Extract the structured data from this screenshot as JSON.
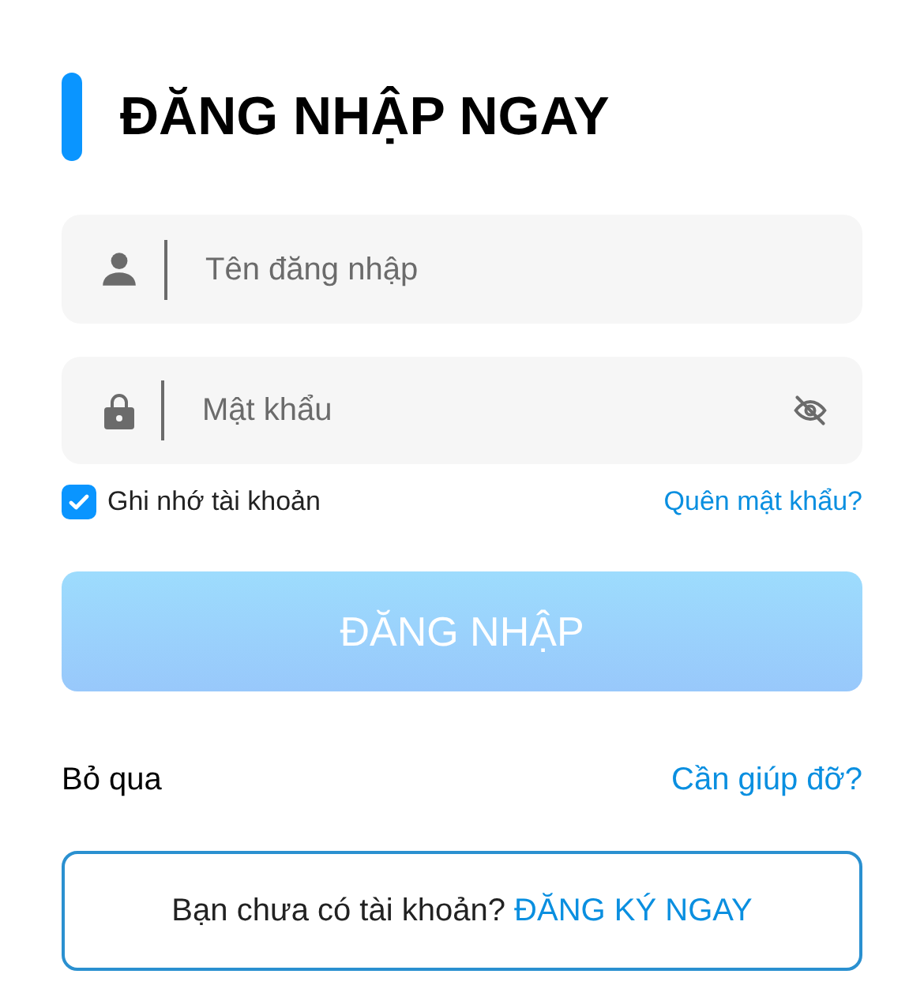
{
  "title": "ĐĂNG NHẬP NGAY",
  "username": {
    "placeholder": "Tên đăng nhập"
  },
  "password": {
    "placeholder": "Mật khẩu"
  },
  "remember": {
    "label": "Ghi nhớ tài khoản",
    "checked": true
  },
  "forgot_link": "Quên mật khẩu?",
  "login_button": {
    "label": "ĐĂNG NHẬP",
    "disabled": true
  },
  "skip_link": "Bỏ qua",
  "help_link": "Cần giúp đỡ?",
  "register": {
    "prompt": "Bạn chưa có tài khoản?",
    "link": "ĐĂNG KÝ NGAY"
  }
}
